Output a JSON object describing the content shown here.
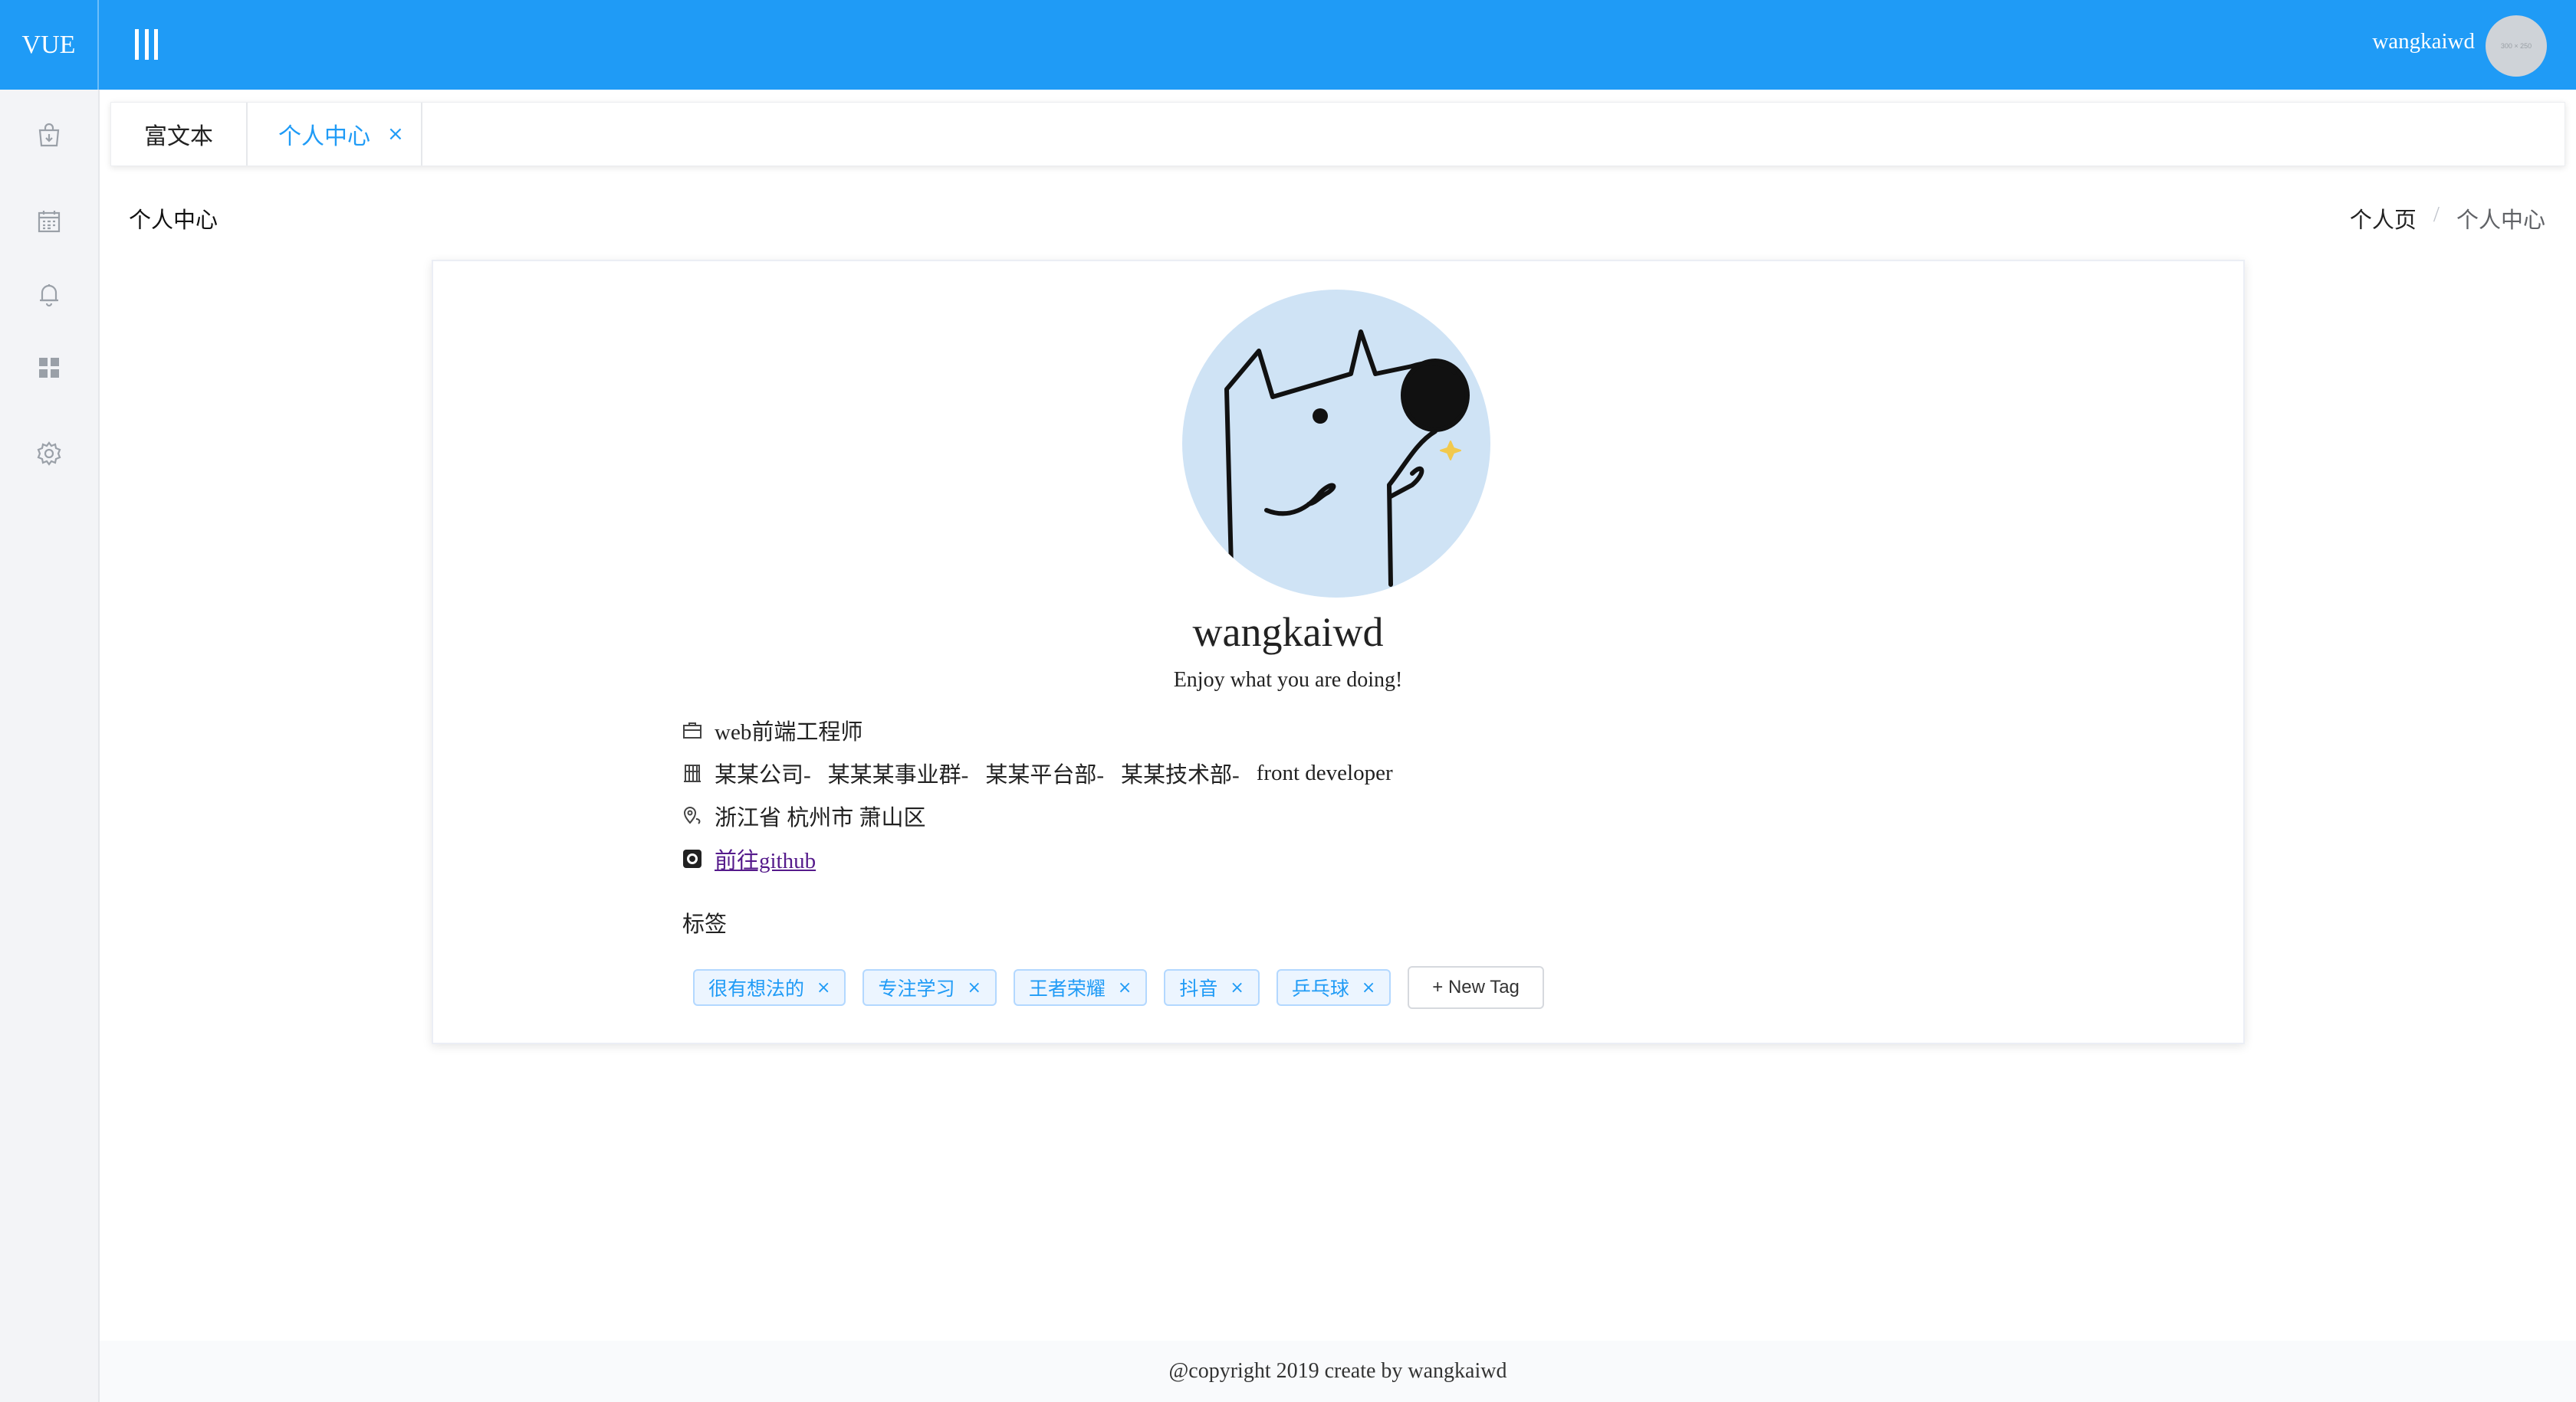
{
  "header": {
    "logo": "VUE",
    "username": "wangkaiwd",
    "avatar_text": "300 × 250"
  },
  "sidebar": {
    "items": [
      {
        "icon": "shopping-bag-icon"
      },
      {
        "icon": "calendar-icon"
      },
      {
        "icon": "bell-icon"
      },
      {
        "icon": "grid-icon"
      },
      {
        "icon": "gear-icon"
      }
    ]
  },
  "tabs": [
    {
      "label": "富文本",
      "active": false
    },
    {
      "label": "个人中心",
      "active": true,
      "close": "×"
    }
  ],
  "page": {
    "title": "个人中心",
    "breadcrumb": [
      "个人页",
      "个人中心"
    ],
    "breadcrumb_separator": "/"
  },
  "profile": {
    "name": "wangkaiwd",
    "bio": "Enjoy what you are doing!",
    "job": "web前端工程师",
    "org": [
      "某某公司-",
      "某某某事业群-",
      "某某平台部-",
      "某某技术部-",
      "front developer"
    ],
    "location": "浙江省 杭州市 萧山区",
    "github_link": "前往github"
  },
  "tags": {
    "title": "标签",
    "items": [
      "很有想法的",
      "专注学习",
      "王者荣耀",
      "抖音",
      "乒乓球"
    ],
    "close": "×",
    "new_tag_label": "+ New Tag"
  },
  "footer": {
    "text": "@copyright 2019 create by wangkaiwd"
  },
  "colors": {
    "primary": "#1f9bf6",
    "tag_bg": "#ecf5ff",
    "avatar_bg": "#cfe3f5"
  }
}
